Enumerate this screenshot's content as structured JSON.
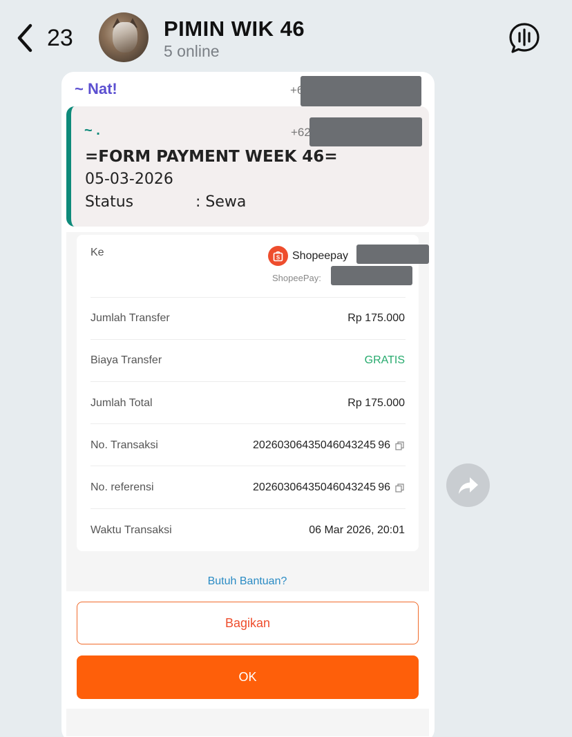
{
  "header": {
    "back_count": "23",
    "title": "PIMIN WIK 46",
    "subtitle": "5 online",
    "avatar_icon": "cat-avatar",
    "voice_icon": "voice-chat-icon"
  },
  "message": {
    "sender_name": "~ Nat!",
    "sender_phone_prefix": "+6",
    "quote": {
      "name": "~ .",
      "phone_prefix": "+62",
      "title": "=FORM PAYMENT WEEK 46=",
      "date": "05-03-2026",
      "status_label": "Status",
      "status_value": ": Sewa",
      "accent_color": "#0e8a7a"
    },
    "receipt": {
      "to_label": "Ke",
      "wallet_name": "Shopeepay",
      "wallet_sub": "ShopeePay:",
      "rows": [
        {
          "label": "Jumlah Transfer",
          "value": "Rp 175.000"
        },
        {
          "label": "Biaya Transfer",
          "value": "GRATIS"
        },
        {
          "label": "Jumlah Total",
          "value": "Rp 175.000"
        },
        {
          "label": "No. Transaksi",
          "value": "20260306435046043245 96"
        },
        {
          "label": "No. referensi",
          "value": "20260306435046043245 96"
        },
        {
          "label": "Waktu Transaksi",
          "value": "06 Mar 2026, 20:01"
        }
      ],
      "help_link": "Butuh Bantuan?",
      "share_button": "Bagikan",
      "ok_button": "OK",
      "brand_color": "#ee4d2d",
      "gratis_color": "#26aa6d"
    }
  }
}
